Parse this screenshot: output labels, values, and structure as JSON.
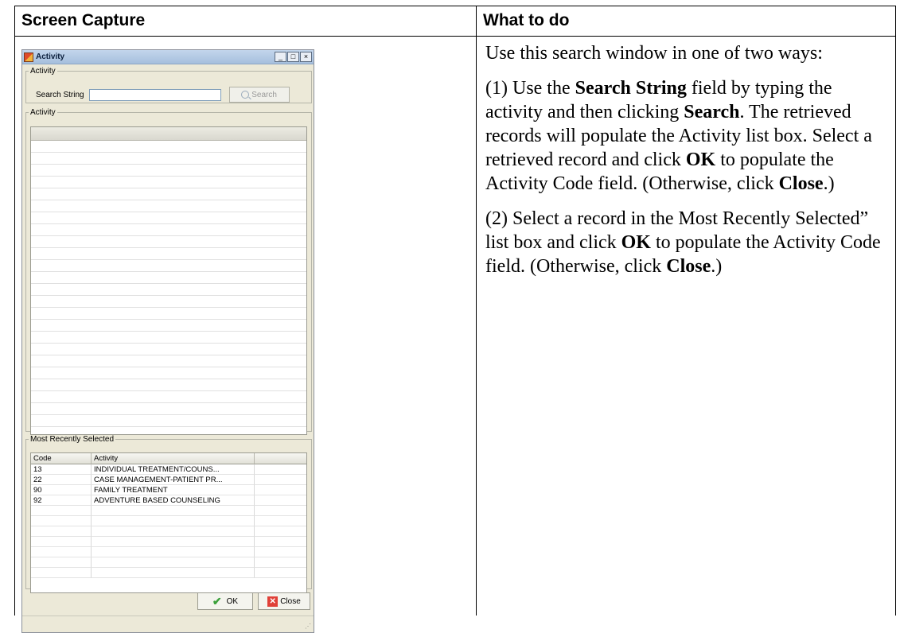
{
  "table": {
    "col_left_header": "Screen Capture",
    "col_right_header": "What to do"
  },
  "dialog": {
    "title": "Activity",
    "window_buttons": {
      "minimize": "_",
      "maximize": "□",
      "close": "×"
    },
    "search_group": {
      "legend": "Activity",
      "label": "Search String",
      "value": "",
      "button": "Search"
    },
    "activity_group": {
      "legend": "Activity"
    },
    "recent_group": {
      "legend": "Most Recently Selected",
      "columns": [
        "Code",
        "Activity"
      ],
      "rows": [
        [
          "13",
          "INDIVIDUAL TREATMENT/COUNS..."
        ],
        [
          "22",
          "CASE MANAGEMENT-PATIENT PR..."
        ],
        [
          "90",
          "FAMILY TREATMENT"
        ],
        [
          "92",
          "ADVENTURE BASED COUNSELING"
        ]
      ]
    },
    "ok_button": "OK",
    "close_button": "Close"
  },
  "instructions": {
    "p1": "Use this search window in one of two ways:",
    "p2_a": "(1) Use the ",
    "p2_b": "Search String",
    "p2_c": " field by typing the activity and then clicking ",
    "p2_d": "Search",
    "p2_e": ". The retrieved records will populate the Activity list box. Select a retrieved record and click ",
    "p2_f": "OK",
    "p2_g": " to populate the Activity Code field. (Otherwise, click ",
    "p2_h": "Close",
    "p2_i": ".)",
    "p3_a": "(2) Select a record in the Most Recently Selected” list box and click ",
    "p3_b": "OK",
    "p3_c": " to populate the Activity Code field. (Otherwise, click ",
    "p3_d": "Close",
    "p3_e": ".)"
  }
}
